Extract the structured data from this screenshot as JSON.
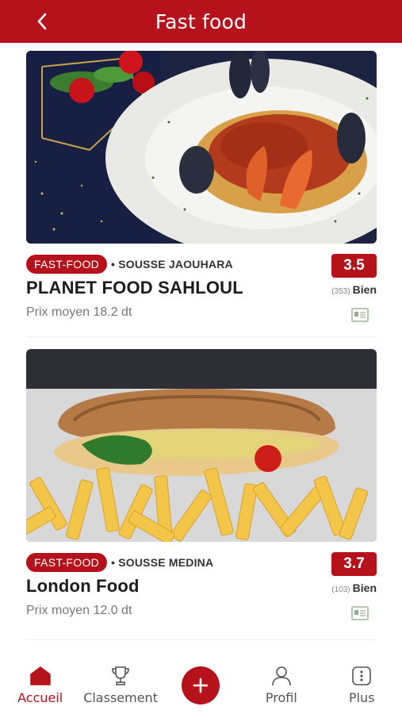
{
  "header": {
    "title": "Fast food",
    "back_icon": "chevron-left-icon"
  },
  "restaurants": [
    {
      "category": "FAST-FOOD",
      "location": "• SOUSSE JAOUHARA",
      "name": "PLANET FOOD SAHLOUL",
      "price": "Prix moyen 18.2 dt",
      "rating": "3.5",
      "review_count": "(353)",
      "verdict": "Bien",
      "photo": "seafood-spaghetti-photo"
    },
    {
      "category": "FAST-FOOD",
      "location": "• SOUSSE MEDINA",
      "name": "London Food",
      "price": "Prix moyen 12.0 dt",
      "rating": "3.7",
      "review_count": "(103)",
      "verdict": "Bien",
      "photo": "sandwich-fries-photo"
    }
  ],
  "bottom_nav": {
    "items": [
      {
        "label": "Accueil",
        "icon": "home-icon",
        "active": true
      },
      {
        "label": "Classement",
        "icon": "trophy-icon"
      },
      {
        "label": "",
        "icon": "plus-icon"
      },
      {
        "label": "Profil",
        "icon": "user-icon"
      },
      {
        "label": "Plus",
        "icon": "more-icon"
      }
    ]
  },
  "colors": {
    "brand": "#b5121b",
    "text": "#222222",
    "muted": "#777777"
  }
}
